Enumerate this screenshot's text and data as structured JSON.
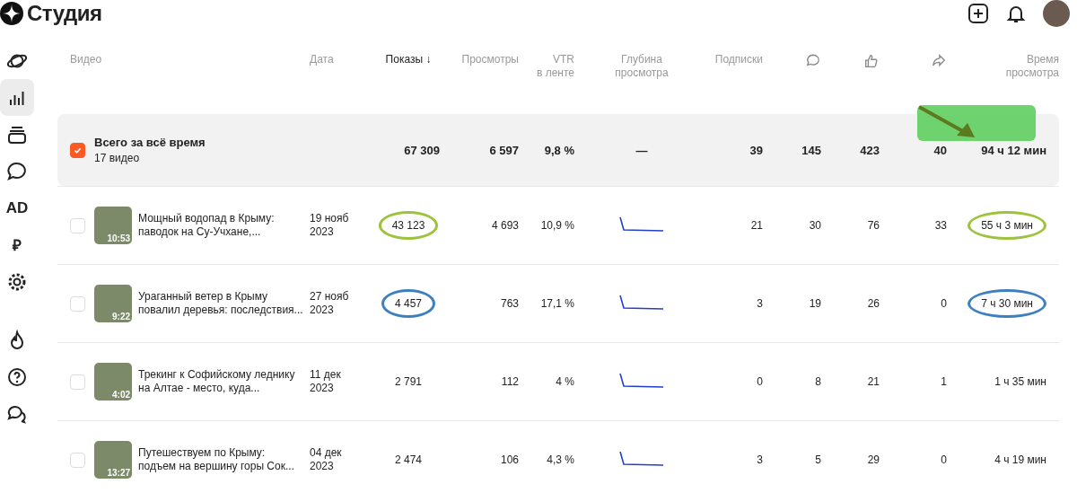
{
  "header": {
    "title": "Студия"
  },
  "sidebar": {
    "items": [
      {
        "kind": "icon",
        "selected": false
      },
      {
        "kind": "icon",
        "selected": true
      },
      {
        "kind": "icon",
        "selected": false
      },
      {
        "kind": "icon",
        "selected": false
      },
      {
        "kind": "text",
        "label": "AD",
        "selected": false
      },
      {
        "kind": "text",
        "label": "₽",
        "selected": false
      },
      {
        "kind": "icon",
        "selected": false
      },
      {
        "kind": "icon",
        "selected": false
      },
      {
        "kind": "icon",
        "selected": false
      },
      {
        "kind": "icon",
        "selected": false
      }
    ]
  },
  "table": {
    "columns": [
      {
        "kind": "text",
        "label": "Видео",
        "selected": false
      },
      {
        "kind": "text",
        "label": "Дата",
        "selected": false
      },
      {
        "kind": "text",
        "label": "Показы",
        "sort_arrow": "↓",
        "selected": true
      },
      {
        "kind": "text",
        "label": "Просмотры",
        "selected": false
      },
      {
        "kind": "text",
        "label": "VTR\nв ленте",
        "selected": false
      },
      {
        "kind": "text",
        "label": "Глубина\nпросмотра",
        "selected": false
      },
      {
        "kind": "text",
        "label": "Подписки",
        "selected": false
      },
      {
        "kind": "icon",
        "selected": false
      },
      {
        "kind": "icon",
        "selected": false
      },
      {
        "kind": "icon",
        "selected": false
      },
      {
        "kind": "text",
        "label": "Время\nпросмотра",
        "selected": false
      }
    ],
    "total": {
      "checked": true,
      "title": "Всего за всё время",
      "subtitle": "17 видео",
      "impressions": "67 309",
      "views": "6 597",
      "vtr": "9,8 %",
      "depth": "—",
      "subscriptions": "39",
      "comments": "145",
      "likes": "423",
      "shares": "40",
      "watch_time": "94 ч 12 мин"
    },
    "rows": [
      {
        "checked": false,
        "duration": "10:53",
        "title": "Мощный водопад в Крыму: паводок на Су-Учхане,...",
        "date": "19 нояб\n2023",
        "impressions": "43 123",
        "views": "4 693",
        "vtr": "10,9 %",
        "subscriptions": "21",
        "comments": "30",
        "likes": "76",
        "shares": "33",
        "watch_time": "55 ч 3 мин",
        "color": "#9dc23c"
      },
      {
        "checked": false,
        "duration": "9:22",
        "title": "Ураганный ветер в Крыму повалил деревья: последствия...",
        "date": "27 нояб\n2023",
        "impressions": "4 457",
        "views": "763",
        "vtr": "17,1 %",
        "subscriptions": "3",
        "comments": "19",
        "likes": "26",
        "shares": "0",
        "watch_time": "7 ч 30 мин",
        "color": "#3f7fbf"
      },
      {
        "checked": false,
        "duration": "4:02",
        "title": "Трекинг к Софийскому леднику на Алтае - место, куда...",
        "date": "11 дек\n2023",
        "impressions": "2 791",
        "views": "112",
        "vtr": "4 %",
        "subscriptions": "0",
        "comments": "8",
        "likes": "21",
        "shares": "1",
        "watch_time": "1 ч 35 мин"
      },
      {
        "checked": false,
        "duration": "13:27",
        "title": "Путешествуем по Крыму: подъем на вершину горы Сок...",
        "date": "04 дек\n2023",
        "impressions": "2 474",
        "views": "106",
        "vtr": "4,3 %",
        "subscriptions": "3",
        "comments": "5",
        "likes": "29",
        "shares": "0",
        "watch_time": "4 ч 19 мин"
      }
    ]
  }
}
